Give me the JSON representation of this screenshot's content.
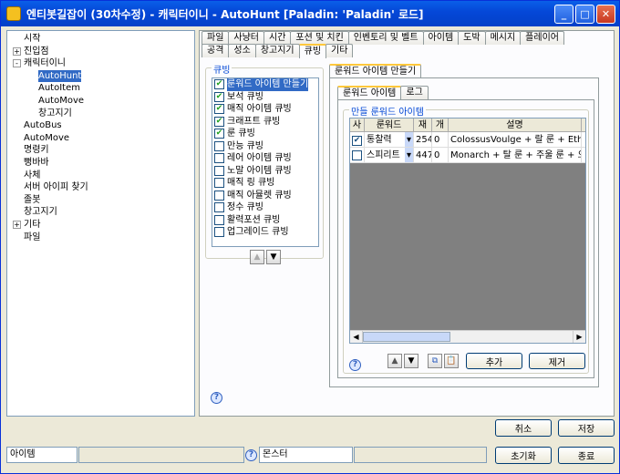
{
  "window": {
    "title": "엔티봇길잡이 (30차수정) - 캐릭터이니 - AutoHunt [Paladin: 'Paladin' 로드]"
  },
  "tree": [
    {
      "label": "시작",
      "expander": ""
    },
    {
      "label": "진입점",
      "expander": "+"
    },
    {
      "label": "캐릭터이니",
      "expander": "-"
    },
    {
      "label": "AutoHunt",
      "indent": 1,
      "selected": true
    },
    {
      "label": "AutoItem",
      "indent": 1
    },
    {
      "label": "AutoMove",
      "indent": 1
    },
    {
      "label": "창고지기",
      "indent": 1
    },
    {
      "label": "AutoBus"
    },
    {
      "label": "AutoMove"
    },
    {
      "label": "명령키"
    },
    {
      "label": "뻥바바"
    },
    {
      "label": "사체"
    },
    {
      "label": "서버 아이피 찾기"
    },
    {
      "label": "졸봇"
    },
    {
      "label": "창고지기"
    },
    {
      "label": "기타",
      "expander": "+"
    },
    {
      "label": "파일"
    }
  ],
  "tabs_row1": [
    "파일",
    "사냥터",
    "시간",
    "포션 및 치킨",
    "인벤토리 및 벨트",
    "아이템",
    "도박",
    "메시지",
    "플레이어"
  ],
  "tabs_row2": [
    "공격",
    "성소",
    "창고지기",
    "큐빙",
    "기타"
  ],
  "active_tab": "큐빙",
  "cubing": {
    "group_label": "큐빙",
    "items": [
      {
        "label": "룬워드 아이템 만들기",
        "checked": true,
        "selected": true
      },
      {
        "label": "보석 큐빙",
        "checked": true
      },
      {
        "label": "매직 아이템 큐빙",
        "checked": true
      },
      {
        "label": "크래프트 큐빙",
        "checked": true
      },
      {
        "label": "룬 큐빙",
        "checked": true
      },
      {
        "label": "만능 큐빙",
        "checked": false
      },
      {
        "label": "레어 아이템 큐빙",
        "checked": false
      },
      {
        "label": "노말 아이템 큐빙",
        "checked": false
      },
      {
        "label": "매직 링 큐빙",
        "checked": false
      },
      {
        "label": "매직 아뮬렛 큐빙",
        "checked": false
      },
      {
        "label": "정수 큐빙",
        "checked": false
      },
      {
        "label": "활력포션 큐빙",
        "checked": false
      },
      {
        "label": "업그레이드 큐빙",
        "checked": false
      }
    ]
  },
  "runeword": {
    "outer_tab": "룬워드 아이템 만들기",
    "inner_tabs": [
      "룬워드 아이템",
      "로그"
    ],
    "group_label": "만들 룬워드 아이템",
    "columns": [
      "사",
      "룬워드",
      "재",
      "개",
      "설명"
    ],
    "rows": [
      {
        "checked": true,
        "name": "통찰력",
        "qty": "254",
        "count": "0",
        "desc": "ColossusVoulge + 랄 룬 + Eth"
      },
      {
        "checked": false,
        "name": "스피리트",
        "qty": "447",
        "count": "0",
        "desc": "Monarch + 탈 룬 + 주울 룬 + 오"
      }
    ],
    "add_label": "추가",
    "remove_label": "제거"
  },
  "buttons": {
    "cancel": "취소",
    "save": "저장",
    "reset": "초기화",
    "exit": "종료"
  },
  "status": {
    "left": "아이템",
    "monster": "몬스터"
  }
}
